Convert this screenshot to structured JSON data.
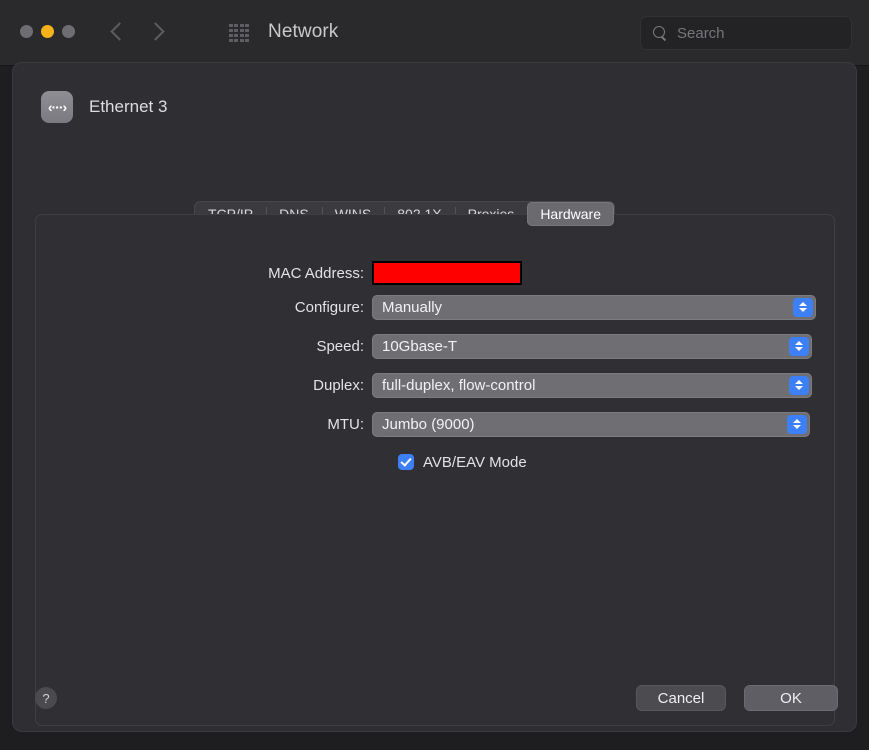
{
  "window": {
    "title": "Network",
    "traffic_lights": [
      {
        "name": "close",
        "color": "#6e6e72"
      },
      {
        "name": "minimize",
        "color": "#f6b319"
      },
      {
        "name": "zoom",
        "color": "#6e6e72"
      }
    ],
    "nav": {
      "back": "back-chevron",
      "forward": "forward-chevron"
    },
    "show_all_icon": "grid-icon"
  },
  "search": {
    "placeholder": "Search",
    "value": "",
    "icon": "search-icon"
  },
  "sheet": {
    "interface_icon": "ethernet-icon",
    "interface_glyph": "‹···›",
    "interface_name": "Ethernet 3"
  },
  "tabs": [
    {
      "id": "tcpip",
      "label": "TCP/IP",
      "selected": false
    },
    {
      "id": "dns",
      "label": "DNS",
      "selected": false
    },
    {
      "id": "wins",
      "label": "WINS",
      "selected": false
    },
    {
      "id": "8021x",
      "label": "802.1X",
      "selected": false
    },
    {
      "id": "proxies",
      "label": "Proxies",
      "selected": false
    },
    {
      "id": "hardware",
      "label": "Hardware",
      "selected": true
    }
  ],
  "hardware": {
    "mac_address": {
      "label": "MAC Address:",
      "value": "",
      "redacted": true,
      "redaction_color": "#ff0000",
      "redaction_border_color": "#000000"
    },
    "configure": {
      "label": "Configure:",
      "value": "Manually"
    },
    "speed": {
      "label": "Speed:",
      "value": "10Gbase-T"
    },
    "duplex": {
      "label": "Duplex:",
      "value": "full-duplex, flow-control"
    },
    "mtu": {
      "label": "MTU:",
      "value": "Jumbo  (9000)"
    },
    "avb": {
      "label": "AVB/EAV Mode",
      "checked": true
    }
  },
  "footer": {
    "help_label": "?",
    "cancel_label": "Cancel",
    "ok_label": "OK"
  },
  "colors": {
    "accent_blue": "#3d7ff5",
    "toolbar_bg": "#2a2a2c",
    "sheet_bg": "#2e2e33",
    "popup_bg": "#6e6e73",
    "selected_tab_bg": "#6a6a6f"
  }
}
